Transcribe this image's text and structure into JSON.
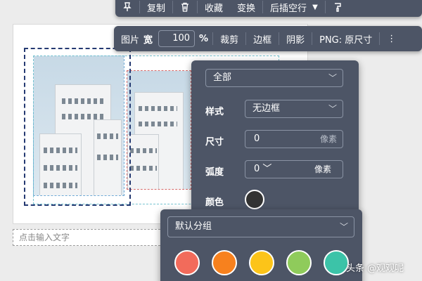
{
  "toolbar_top": {
    "copy_label": "复制",
    "favorite_label": "收藏",
    "transform_label": "变换",
    "line_spacing_label": "后插空行"
  },
  "toolbar_image": {
    "image_label": "图片",
    "width_label": "宽",
    "width_value": "100",
    "percent_symbol": "%",
    "crop_label": "裁剪",
    "border_label": "边框",
    "shadow_label": "阴影",
    "export_label": "PNG: 原尺寸"
  },
  "style_panel": {
    "category_value": "全部",
    "style_label": "样式",
    "style_value": "无边框",
    "size_label": "尺寸",
    "size_value": "0",
    "size_unit": "像素",
    "radius_label": "弧度",
    "radius_value": "0",
    "radius_unit": "像素",
    "color_label": "颜色",
    "current_color": "#333333"
  },
  "palette_panel": {
    "group_value": "默认分组",
    "swatches": [
      "#f26b5b",
      "#f7811e",
      "#fcc419",
      "#8fcb5b",
      "#3cc3a8"
    ]
  },
  "document": {
    "text_placeholder": "点击输入文字"
  },
  "watermark": "头条 @观观呢"
}
